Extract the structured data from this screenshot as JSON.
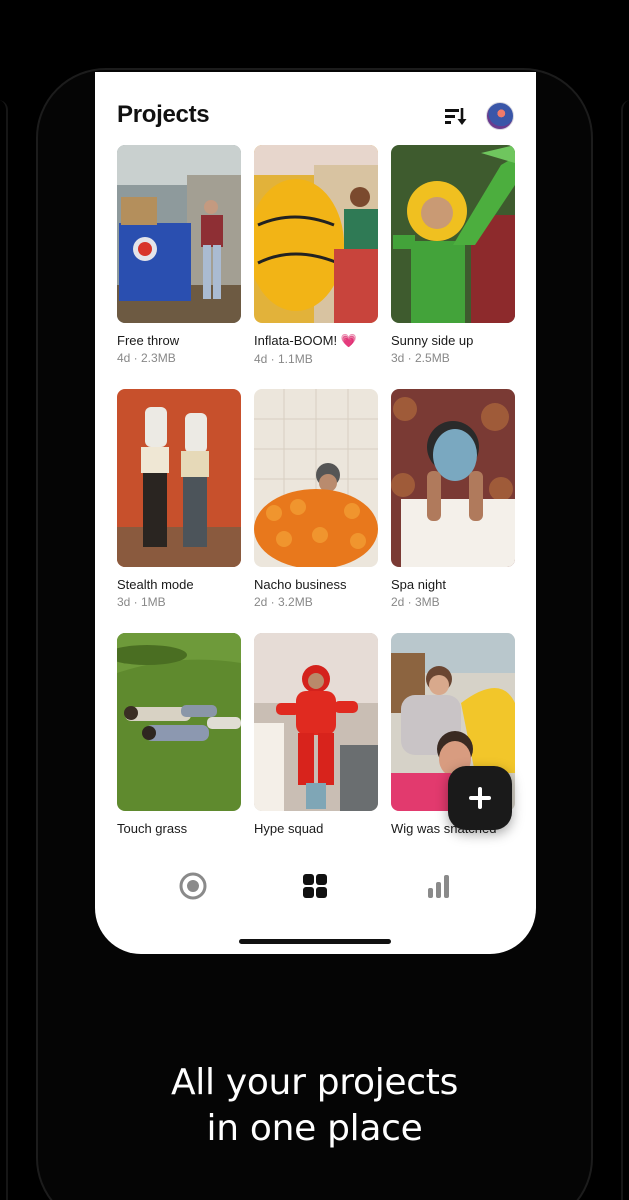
{
  "screen": {
    "title": "Projects",
    "header_icons": [
      "sort-descending-icon",
      "profile-avatar"
    ]
  },
  "projects": [
    {
      "title": "Free throw",
      "meta": "4d · 2.3MB"
    },
    {
      "title": "Inflata-BOOM! 💗",
      "meta": "4d · 1.1MB"
    },
    {
      "title": "Sunny side up",
      "meta": "3d · 2.5MB"
    },
    {
      "title": "Stealth mode",
      "meta": "3d · 1MB"
    },
    {
      "title": "Nacho business",
      "meta": "2d · 3.2MB"
    },
    {
      "title": "Spa night",
      "meta": "2d · 3MB"
    },
    {
      "title": "Touch grass",
      "meta": ""
    },
    {
      "title": "Hype squad",
      "meta": ""
    },
    {
      "title": "Wig was snatched",
      "meta": ""
    }
  ],
  "fab": {
    "icon": "plus-icon"
  },
  "bottom_nav": {
    "items": [
      "record-icon",
      "projects-grid-icon",
      "stats-bars-icon"
    ],
    "active": "projects-grid-icon"
  },
  "caption": {
    "line1": "All your projects",
    "line2": "in one place"
  },
  "colors": {
    "background": "#000000",
    "screen": "#ffffff",
    "fab": "#1a1a1a",
    "nav_inactive": "#8a8a8a"
  }
}
